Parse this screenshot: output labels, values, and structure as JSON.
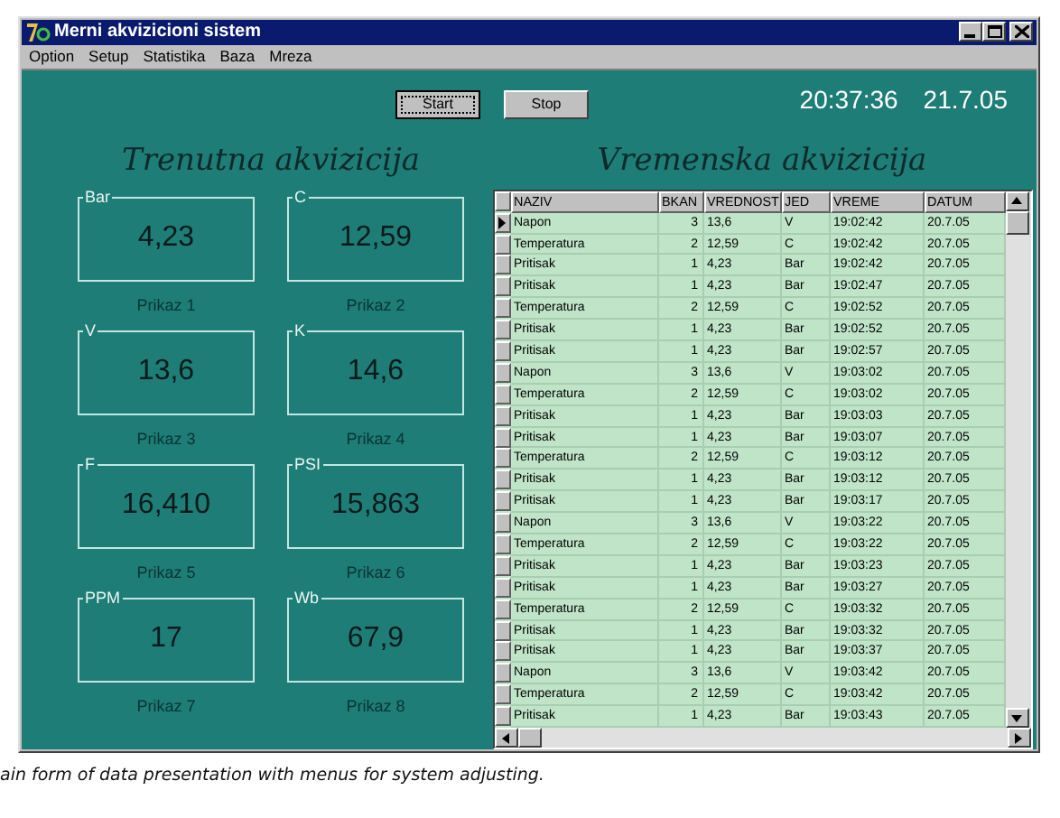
{
  "window": {
    "title": "Merni akvizicioni sistem"
  },
  "menu": [
    "Option",
    "Setup",
    "Statistika",
    "Baza",
    "Mreza"
  ],
  "buttons": [
    {
      "label": "Start",
      "focused": true
    },
    {
      "label": "Stop",
      "focused": false
    }
  ],
  "clock": {
    "time": "20:37:36",
    "date": "21.7.05"
  },
  "left_heading": "Trenutna akvizicija",
  "right_heading": "Vremenska akvizicija",
  "displays": [
    {
      "unit": "Bar",
      "value": "4,23",
      "caption": "Prikaz 1"
    },
    {
      "unit": "C",
      "value": "12,59",
      "caption": "Prikaz 2"
    },
    {
      "unit": "V",
      "value": "13,6",
      "caption": "Prikaz 3"
    },
    {
      "unit": "K",
      "value": "14,6",
      "caption": "Prikaz 4"
    },
    {
      "unit": "F",
      "value": "16,410",
      "caption": "Prikaz 5"
    },
    {
      "unit": "PSI",
      "value": "15,863",
      "caption": "Prikaz 6"
    },
    {
      "unit": "PPM",
      "value": "17",
      "caption": "Prikaz 7"
    },
    {
      "unit": "Wb",
      "value": "67,9",
      "caption": "Prikaz 8"
    }
  ],
  "table": {
    "columns": [
      "NAZIV",
      "BKAN",
      "VREDNOST",
      "JED",
      "VREME",
      "DATUM"
    ],
    "rows": [
      {
        "cells": [
          "Napon",
          "3",
          "13,6",
          "V",
          "19:02:42",
          "20.7.05"
        ],
        "selected": true
      },
      {
        "cells": [
          "Temperatura",
          "2",
          "12,59",
          "C",
          "19:02:42",
          "20.7.05"
        ],
        "selected": false
      },
      {
        "cells": [
          "Pritisak",
          "1",
          "4,23",
          "Bar",
          "19:02:42",
          "20.7.05"
        ],
        "selected": false
      },
      {
        "cells": [
          "Pritisak",
          "1",
          "4,23",
          "Bar",
          "19:02:47",
          "20.7.05"
        ],
        "selected": false
      },
      {
        "cells": [
          "Temperatura",
          "2",
          "12,59",
          "C",
          "19:02:52",
          "20.7.05"
        ],
        "selected": false
      },
      {
        "cells": [
          "Pritisak",
          "1",
          "4,23",
          "Bar",
          "19:02:52",
          "20.7.05"
        ],
        "selected": false
      },
      {
        "cells": [
          "Pritisak",
          "1",
          "4,23",
          "Bar",
          "19:02:57",
          "20.7.05"
        ],
        "selected": false
      },
      {
        "cells": [
          "Napon",
          "3",
          "13,6",
          "V",
          "19:03:02",
          "20.7.05"
        ],
        "selected": false
      },
      {
        "cells": [
          "Temperatura",
          "2",
          "12,59",
          "C",
          "19:03:02",
          "20.7.05"
        ],
        "selected": false
      },
      {
        "cells": [
          "Pritisak",
          "1",
          "4,23",
          "Bar",
          "19:03:03",
          "20.7.05"
        ],
        "selected": false
      },
      {
        "cells": [
          "Pritisak",
          "1",
          "4,23",
          "Bar",
          "19:03:07",
          "20.7.05"
        ],
        "selected": false
      },
      {
        "cells": [
          "Temperatura",
          "2",
          "12,59",
          "C",
          "19:03:12",
          "20.7.05"
        ],
        "selected": false
      },
      {
        "cells": [
          "Pritisak",
          "1",
          "4,23",
          "Bar",
          "19:03:12",
          "20.7.05"
        ],
        "selected": false
      },
      {
        "cells": [
          "Pritisak",
          "1",
          "4,23",
          "Bar",
          "19:03:17",
          "20.7.05"
        ],
        "selected": false
      },
      {
        "cells": [
          "Napon",
          "3",
          "13,6",
          "V",
          "19:03:22",
          "20.7.05"
        ],
        "selected": false
      },
      {
        "cells": [
          "Temperatura",
          "2",
          "12,59",
          "C",
          "19:03:22",
          "20.7.05"
        ],
        "selected": false
      },
      {
        "cells": [
          "Pritisak",
          "1",
          "4,23",
          "Bar",
          "19:03:23",
          "20.7.05"
        ],
        "selected": false
      },
      {
        "cells": [
          "Pritisak",
          "1",
          "4,23",
          "Bar",
          "19:03:27",
          "20.7.05"
        ],
        "selected": false
      },
      {
        "cells": [
          "Temperatura",
          "2",
          "12,59",
          "C",
          "19:03:32",
          "20.7.05"
        ],
        "selected": false
      },
      {
        "cells": [
          "Pritisak",
          "1",
          "4,23",
          "Bar",
          "19:03:32",
          "20.7.05"
        ],
        "selected": false
      },
      {
        "cells": [
          "Pritisak",
          "1",
          "4,23",
          "Bar",
          "19:03:37",
          "20.7.05"
        ],
        "selected": false
      },
      {
        "cells": [
          "Napon",
          "3",
          "13,6",
          "V",
          "19:03:42",
          "20.7.05"
        ],
        "selected": false
      },
      {
        "cells": [
          "Temperatura",
          "2",
          "12,59",
          "C",
          "19:03:42",
          "20.7.05"
        ],
        "selected": false
      },
      {
        "cells": [
          "Pritisak",
          "1",
          "4,23",
          "Bar",
          "19:03:43",
          "20.7.05"
        ],
        "selected": false
      }
    ]
  },
  "caption": "ain form of data presentation with menus for system adjusting."
}
